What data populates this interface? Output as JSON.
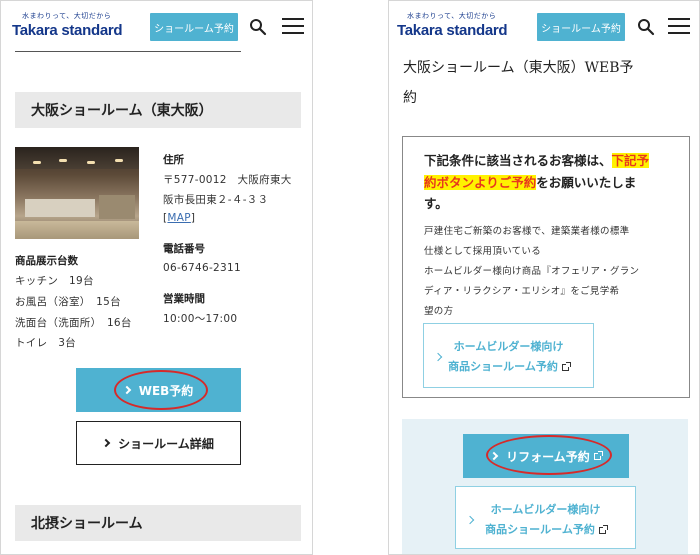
{
  "header": {
    "logo_tagline": "水まわりって、大切だから",
    "logo_text": "Takara standard",
    "reserve_button": "ショールーム予約"
  },
  "left": {
    "section_title": "大阪ショールーム（東大阪）",
    "display_count_label": "商品展示台数",
    "display_items": [
      "キッチン　19台",
      "お風呂（浴室）　15台",
      "洗面台（洗面所）　16台",
      "トイレ　3台"
    ],
    "address_label": "住所",
    "address_lines": [
      "〒577-0012　大阪府東大",
      "阪市長田東２-４-３３"
    ],
    "map_link_open": "[",
    "map_link": "MAP",
    "map_link_close": "]",
    "phone_label": "電話番号",
    "phone": "06-6746-2311",
    "hours_label": "営業時間",
    "hours": "10:00〜17:00",
    "web_reserve_button": "WEB予約",
    "details_button": "ショールーム詳細",
    "next_section_title": "北摂ショールーム"
  },
  "right": {
    "title_line1": "大阪ショールーム（東大阪）WEB予",
    "title_line2": "約",
    "notice_line1_prefix": "下記条件に該当されるお客様は、",
    "notice_line1_highlight": "下記予",
    "notice_line2_highlight": "約ボタンよりご予約",
    "notice_line2_suffix": "をお願いいたしま",
    "notice_line3": "す。",
    "condition_lines": [
      "戸建住宅ご新築のお客様で、建築業者様の標準",
      "仕様として採用頂いている",
      "ホームビルダー様向け商品『オフェリア・グラン",
      "ディア・リラクシア・エリシオ』をご見学希",
      "望の方"
    ],
    "builder_button_line1": "ホームビルダー様向け",
    "builder_button_line2": "商品ショールーム予約",
    "reform_button": "リフォーム予約",
    "builder_button2_line1": "ホームビルダー様向け",
    "builder_button2_line2": "商品ショールーム予約"
  },
  "colors": {
    "accent": "#4fb2d1",
    "logo": "#14378a",
    "highlight_bg": "#fff200",
    "highlight_text": "#e8381c",
    "annotation": "#d62a2a"
  }
}
